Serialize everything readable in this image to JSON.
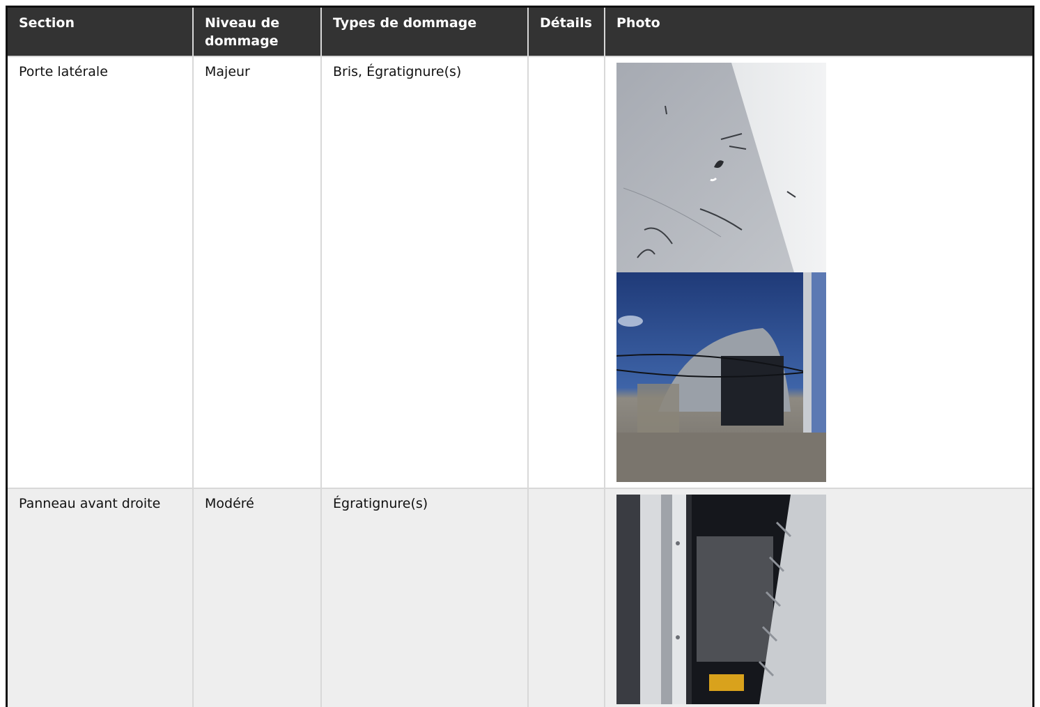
{
  "table": {
    "headers": {
      "section": "Section",
      "niveau": "Niveau de dommage",
      "types": "Types de dommage",
      "details": "Détails",
      "photo": "Photo"
    },
    "rows": [
      {
        "section": "Porte latérale",
        "niveau": "Majeur",
        "types": "Bris, Égratignure(s)",
        "details": ""
      },
      {
        "section": "Panneau avant droite",
        "niveau": "Modéré",
        "types": "Égratignure(s)",
        "details": ""
      }
    ]
  },
  "colors": {
    "header_bg": "#333333",
    "header_text": "#ffffff",
    "row_alt_bg": "#eeeeee",
    "grid": "#d8d8d8"
  }
}
